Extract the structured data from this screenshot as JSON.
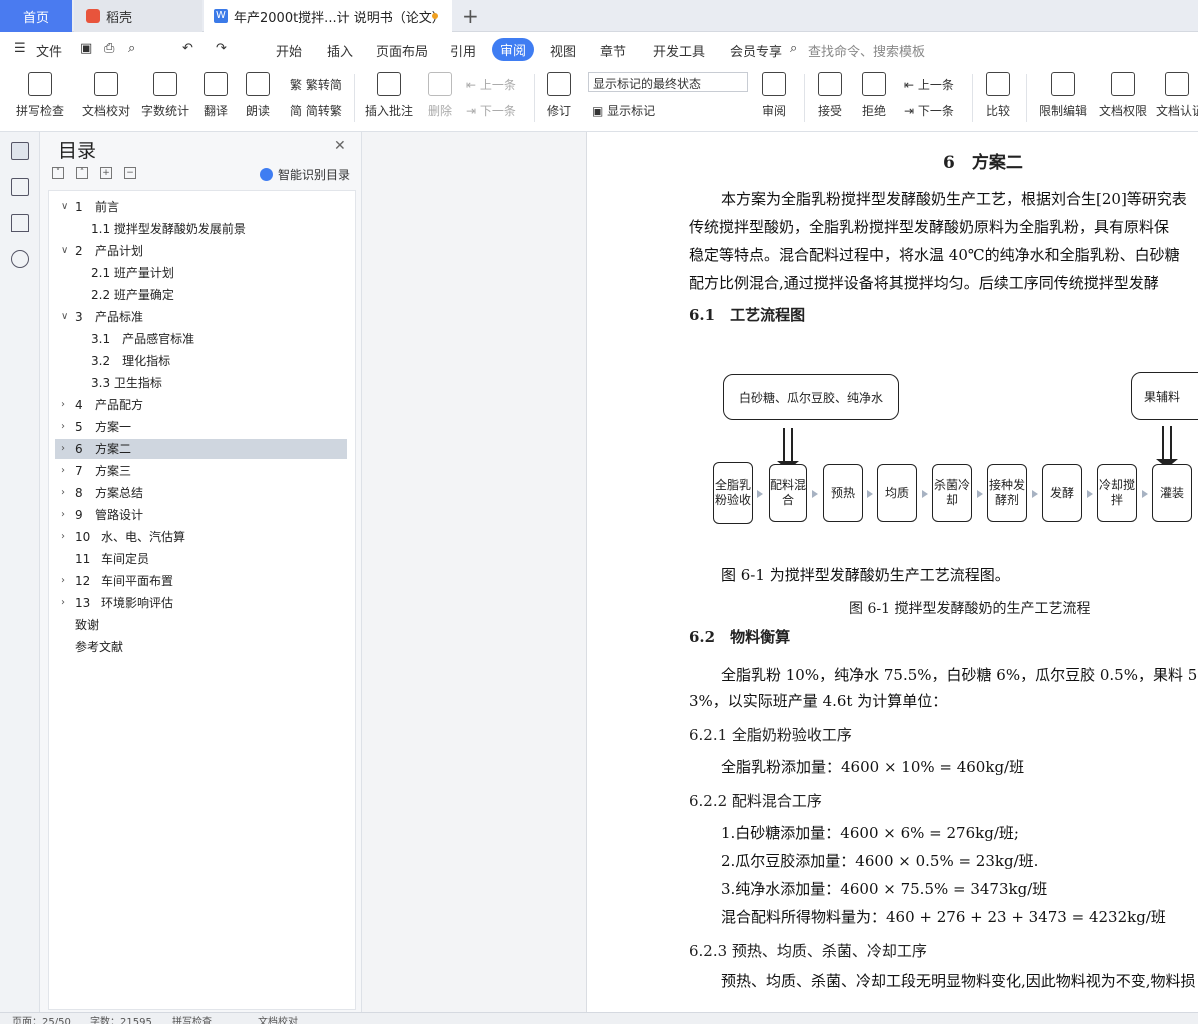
{
  "tabs": {
    "home": "首页",
    "daoke": "稻壳",
    "doc": "年产2000t搅拌...计 说明书（论文）",
    "plus": "+"
  },
  "menu": {
    "file": "文件",
    "items": [
      "开始",
      "插入",
      "页面布局",
      "引用",
      "审阅",
      "视图",
      "章节",
      "开发工具",
      "会员专享"
    ],
    "active": "审阅",
    "search_placeholder": "查找命令、搜索模板"
  },
  "ribbon": {
    "spell": "拼写检查",
    "proofread": "文档校对",
    "wordcount": "字数统计",
    "translate": "翻译",
    "read": "朗读",
    "trad": "繁转简",
    "simp": "简转繁",
    "insert_comment": "插入批注",
    "delete": "删除",
    "prev": "上一条",
    "next": "下一条",
    "revise": "修订",
    "markup_state": "显示标记的最终状态",
    "show_markup": "显示标记",
    "review": "审阅",
    "accept": "接受",
    "reject": "拒绝",
    "prev2": "上一条",
    "next2": "下一条",
    "compare": "比较",
    "restrict": "限制编辑",
    "permission": "文档权限",
    "certify": "文档认证"
  },
  "nav": {
    "title": "目录",
    "smart": "智能识别目录",
    "toc": [
      {
        "num": "1",
        "label": "前言",
        "level": 1,
        "state": "open"
      },
      {
        "num": "",
        "label": "1.1 搅拌型发酵酸奶发展前景",
        "level": 2
      },
      {
        "num": "2",
        "label": "产品计划",
        "level": 1,
        "state": "open"
      },
      {
        "num": "",
        "label": "2.1 班产量计划",
        "level": 2
      },
      {
        "num": "",
        "label": "2.2 班产量确定",
        "level": 2
      },
      {
        "num": "3",
        "label": "产品标准",
        "level": 1,
        "state": "open"
      },
      {
        "num": "",
        "label": "3.1　产品感官标准",
        "level": 2
      },
      {
        "num": "",
        "label": "3.2　理化指标",
        "level": 2
      },
      {
        "num": "",
        "label": "3.3 卫生指标",
        "level": 2
      },
      {
        "num": "4",
        "label": "产品配方",
        "level": 1,
        "state": "closed"
      },
      {
        "num": "5",
        "label": "方案一",
        "level": 1,
        "state": "closed"
      },
      {
        "num": "6",
        "label": "方案二",
        "level": 1,
        "state": "closed",
        "selected": true
      },
      {
        "num": "7",
        "label": "方案三",
        "level": 1,
        "state": "closed"
      },
      {
        "num": "8",
        "label": "方案总结",
        "level": 1,
        "state": "closed"
      },
      {
        "num": "9",
        "label": "管路设计",
        "level": 1,
        "state": "closed"
      },
      {
        "num": "10",
        "label": "水、电、汽估算",
        "level": 1,
        "state": "closed"
      },
      {
        "num": "11",
        "label": "车间定员",
        "level": 1,
        "state": "none"
      },
      {
        "num": "12",
        "label": "车间平面布置",
        "level": 1,
        "state": "closed"
      },
      {
        "num": "13",
        "label": "环境影响评估",
        "level": 1,
        "state": "closed"
      },
      {
        "num": "",
        "label": "致谢",
        "level": 0
      },
      {
        "num": "",
        "label": "参考文献",
        "level": 0
      }
    ]
  },
  "doc": {
    "chapter": "6　方案二",
    "intro": [
      "本方案为全脂乳粉搅拌型发酵酸奶生产工艺，根据刘合生[20]等研究表",
      "传统搅拌型酸奶，全脂乳粉搅拌型发酵酸奶原料为全脂乳粉，具有原料保",
      "稳定等特点。混合配料过程中，将水温 40℃的纯净水和全脂乳粉、白砂糖",
      "配方比例混合,通过搅拌设备将其搅拌均匀。后续工序同传统搅拌型发酵"
    ],
    "s61": "6.1　工艺流程图",
    "flow": {
      "input1": "白砂糖、瓜尔豆胶、纯净水",
      "input2": "果辅料",
      "steps": [
        "全脂乳粉验收",
        "配料混合",
        "预热",
        "均质",
        "杀菌冷却",
        "接种发酵剂",
        "发酵",
        "冷却搅拌",
        "灌装"
      ]
    },
    "fig_text": "图 6-1 为搅拌型发酵酸奶生产工艺流程图。",
    "fig_caption": "图 6-1 搅拌型发酵酸奶的生产工艺流程",
    "s62": "6.2　物料衡算",
    "p62a": "全脂乳粉 10%，纯净水 75.5%，白砂糖 6%，瓜尔豆胶 0.5%，果料 5",
    "p62b": "3%，以实际班产量 4.6t 为计算单位：",
    "s621": "6.2.1  全脂奶粉验收工序",
    "l621": "全脂乳粉添加量：4600 × 10% = 460kg/班",
    "s622": "6.2.2  配料混合工序",
    "l622a": "1.白砂糖添加量：4600 × 6% = 276kg/班;",
    "l622b": "2.瓜尔豆胶添加量：4600 × 0.5% = 23kg/班.",
    "l622c": "3.纯净水添加量：4600 × 75.5% = 3473kg/班",
    "l622d": "混合配料所得物料量为：460 + 276 + 23 + 3473 = 4232kg/班",
    "s623": "6.2.3  预热、均质、杀菌、冷却工序",
    "l623": "预热、均质、杀菌、冷却工段无明显物料变化,因此物料视为不变,物料损"
  },
  "status": {
    "page": "页面：25/50",
    "words": "字数：21595",
    "spell": "拼写检查",
    "proof": "文档校对"
  }
}
